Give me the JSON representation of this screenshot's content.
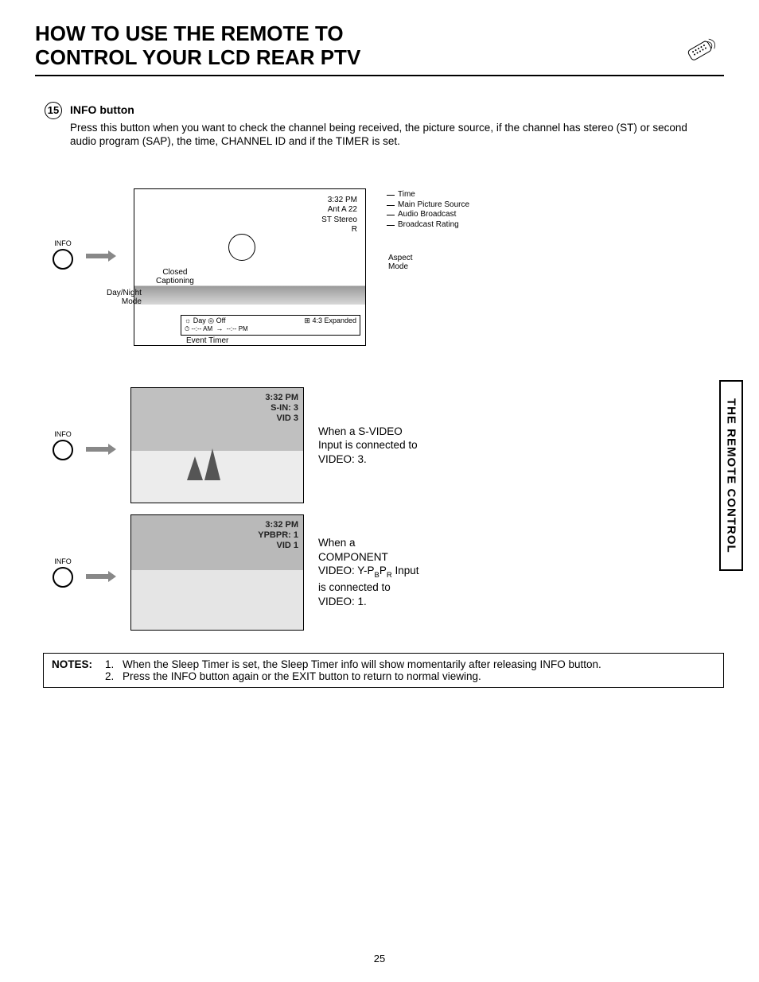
{
  "title_line1": "HOW TO USE THE REMOTE TO",
  "title_line2": "CONTROL YOUR LCD REAR PTV",
  "side_tab": "THE REMOTE CONTROL",
  "item_number": "15",
  "info_button_heading": "INFO button",
  "info_button_body": "Press this button when you want to check the channel being received, the picture source, if the channel has stereo (ST) or second audio program (SAP), the time, CHANNEL ID and if the TIMER is set.",
  "info_btn_label": "INFO",
  "screen1": {
    "time": "3:32 PM",
    "source": "Ant A 22",
    "audio": "ST Stereo",
    "rating": "R",
    "overlay_left": "☼ Day    ◎ Off",
    "overlay_right": "⊞ 4:3 Expanded",
    "overlay_line2_left": "⏱ --:-- AM",
    "overlay_line2_arrow": "→",
    "overlay_line2_right": "--:-- PM"
  },
  "pointer_labels": {
    "time": "Time",
    "source": "Main Picture Source",
    "audio": "Audio Broadcast",
    "rating": "Broadcast Rating",
    "aspect1": "Aspect",
    "aspect2": "Mode",
    "cc1": "Closed",
    "cc2": "Captioning",
    "dn1": "Day/Night",
    "dn2": "Mode",
    "event": "Event Timer"
  },
  "screen2": {
    "line1": "3:32 PM",
    "line2": "S-IN: 3",
    "line3": "VID 3"
  },
  "screen2_desc_l1": "When a S-VIDEO",
  "screen2_desc_l2": "Input is connected to",
  "screen2_desc_l3": "VIDEO: 3.",
  "screen3": {
    "line1": "3:32 PM",
    "line2": "YPBPR: 1",
    "line3": "VID 1"
  },
  "screen3_desc_l1": "When a",
  "screen3_desc_l2": "COMPONENT",
  "screen3_desc_l3a": "VIDEO: Y-P",
  "screen3_desc_l3b": "B",
  "screen3_desc_l3c": "P",
  "screen3_desc_l3d": "R",
  "screen3_desc_l3e": " Input",
  "screen3_desc_l4": "is connected to",
  "screen3_desc_l5": "VIDEO: 1.",
  "notes_label": "NOTES:",
  "notes": [
    {
      "num": "1.",
      "text": "When the Sleep Timer is set, the Sleep Timer info will show momentarily after releasing INFO button."
    },
    {
      "num": "2.",
      "text": "Press the INFO button again or the EXIT button to return to normal viewing."
    }
  ],
  "page_number": "25"
}
